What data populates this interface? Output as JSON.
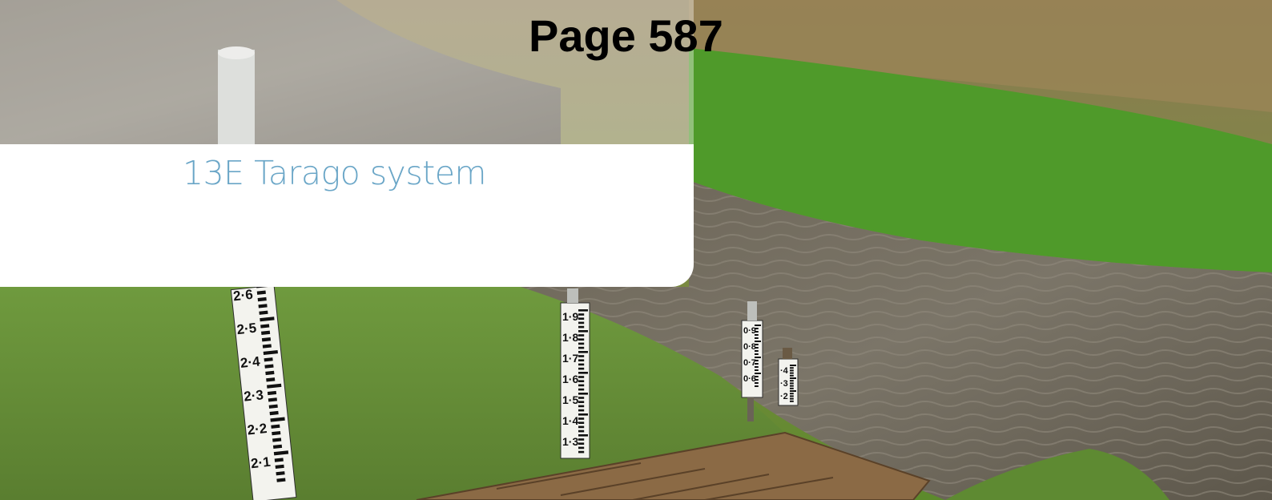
{
  "page": {
    "number_label": "Page 587"
  },
  "section": {
    "title": "13E Tarago system"
  },
  "photo": {
    "gauges": [
      {
        "labels": [
          "2·6",
          "2·5",
          "2·4",
          "2·3",
          "2·2",
          "2·1"
        ]
      },
      {
        "labels": [
          "1·9",
          "1·8",
          "1·7",
          "1·6",
          "1·5",
          "1·4",
          "1·3"
        ]
      },
      {
        "labels": [
          "0·9",
          "0·8",
          "0·7",
          "0·6"
        ]
      },
      {
        "labels": [
          "·4",
          "·3",
          "·2"
        ]
      }
    ]
  },
  "colors": {
    "title": "#6aa6c7",
    "panel": "#ffffff",
    "page_number": "#000000"
  }
}
